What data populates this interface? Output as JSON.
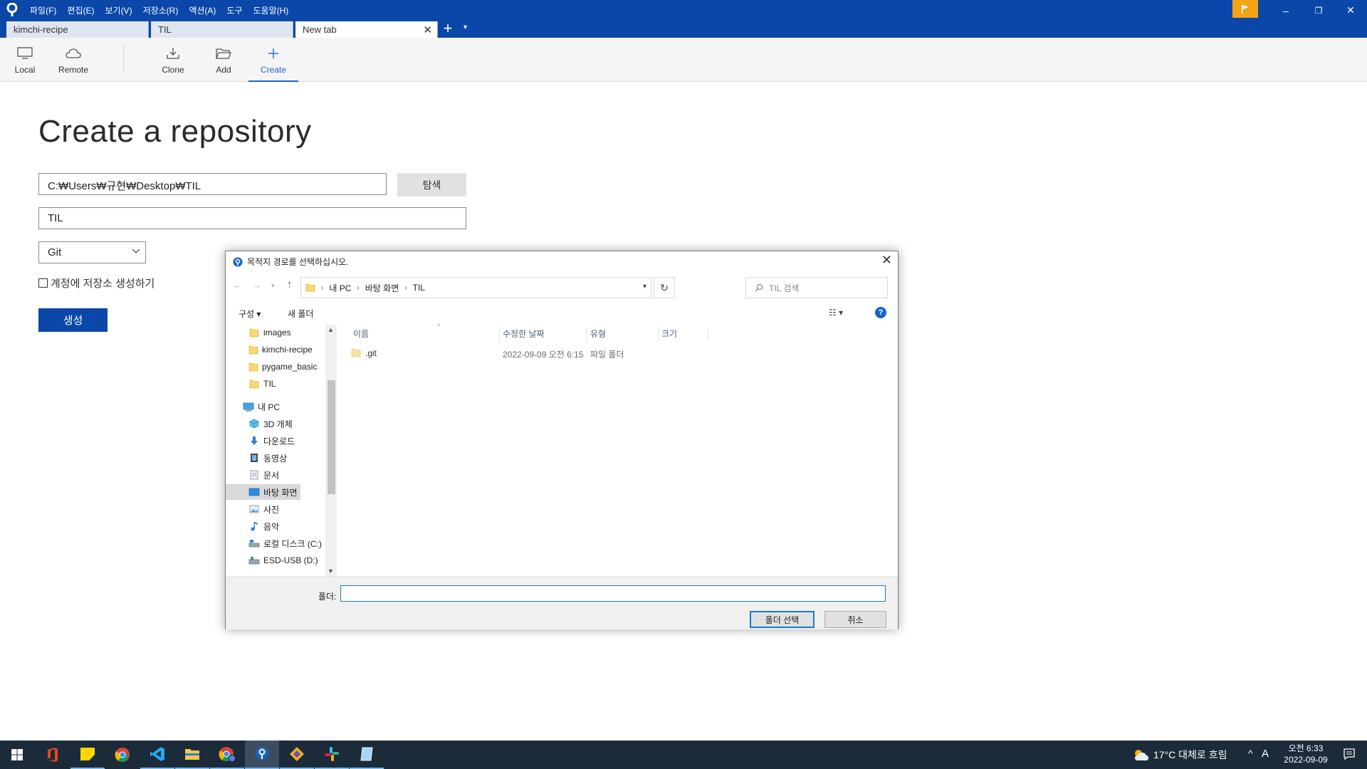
{
  "app": {
    "menu": [
      "파일(F)",
      "편집(E)",
      "보기(V)",
      "저장소(R)",
      "액션(A)",
      "도구",
      "도움말(H)"
    ],
    "window_controls": {
      "minimize": "–",
      "restore": "❐",
      "close": "✕"
    },
    "accent": "#0a47a9",
    "flag_color": "#f5a316"
  },
  "tabs": [
    {
      "label": "kimchi-recipe",
      "active": false
    },
    {
      "label": "TIL",
      "active": false
    },
    {
      "label": "New tab",
      "active": true
    }
  ],
  "tab_controls": {
    "add": "+",
    "dropdown": "▾",
    "close": "✕"
  },
  "toolbar": {
    "local": "Local",
    "remote": "Remote",
    "clone": "Clone",
    "add": "Add",
    "create": "Create",
    "active": "create"
  },
  "main": {
    "title": "Create a repository",
    "path_value": "C:₩Users₩규현₩Desktop₩TIL",
    "browse_label": "탐색",
    "name_value": "TIL",
    "vcs_value": "Git",
    "account_checkbox_label": "계정에 저장소 생성하기",
    "create_label": "생성"
  },
  "dialog": {
    "title": "목적지 경로를 선택하십시오.",
    "breadcrumb": [
      "내 PC",
      "바탕 화면",
      "TIL"
    ],
    "search_placeholder": "TIL 검색",
    "organize": "구성 ▾",
    "new_folder": "새 폴더",
    "nav_items": [
      {
        "label": "images",
        "icon": "folder-icon"
      },
      {
        "label": "kimchi-recipe",
        "icon": "folder-icon"
      },
      {
        "label": "pygame_basic",
        "icon": "folder-icon"
      },
      {
        "label": "TIL",
        "icon": "folder-icon"
      },
      {
        "label": "내 PC",
        "icon": "computer-icon"
      },
      {
        "label": "3D 개체",
        "icon": "3d-objects-icon"
      },
      {
        "label": "다운로드",
        "icon": "download-icon"
      },
      {
        "label": "동영상",
        "icon": "video-icon"
      },
      {
        "label": "문서",
        "icon": "document-icon"
      },
      {
        "label": "바탕 화면",
        "icon": "desktop-icon",
        "selected": true
      },
      {
        "label": "사진",
        "icon": "pictures-icon"
      },
      {
        "label": "음악",
        "icon": "music-icon"
      },
      {
        "label": "로컬 디스크 (C:)",
        "icon": "drive-icon"
      },
      {
        "label": "ESD-USB (D:)",
        "icon": "usb-drive-icon"
      }
    ],
    "columns": {
      "name": "이름",
      "date": "수정한 날짜",
      "type": "유형",
      "size": "크기"
    },
    "files": [
      {
        "name": ".git",
        "date": "2022-09-09 오전 6:15",
        "type": "파일 폴더",
        "size": ""
      }
    ],
    "folder_label": "폴더:",
    "folder_value": "",
    "select_label": "폴더 선택",
    "cancel_label": "취소"
  },
  "taskbar": {
    "weather": "17°C  대체로 흐림",
    "ime": "A",
    "time": "오전 6:33",
    "date": "2022-09-09"
  }
}
